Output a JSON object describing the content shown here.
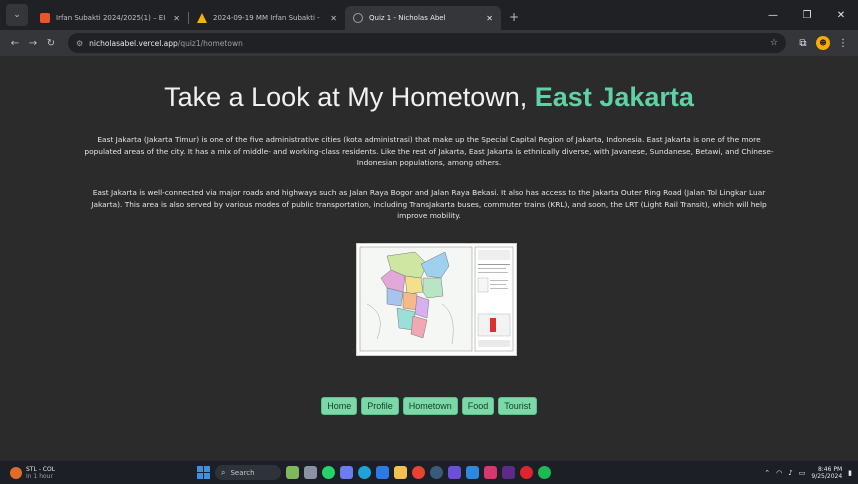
{
  "browser": {
    "tabs": [
      {
        "title": "Irfan Subakti 2024/2025(1) – EI",
        "favicon_color": "#e8542c",
        "active": false
      },
      {
        "title": "2024-09-19 MM Irfan Subakti -",
        "favicon_color": "#f4b400",
        "active": false
      },
      {
        "title": "Quiz 1 - Nicholas Abel",
        "favicon_color": "#9aa0a6",
        "active": true
      }
    ],
    "url_host": "nicholasabel.vercel.app",
    "url_path": "/quiz1/hometown",
    "profile_initial": "☻"
  },
  "page": {
    "heading_prefix": "Take a Look at My Hometown,",
    "heading_accent": "East Jakarta",
    "paragraph1": "East Jakarta (Jakarta Timur) is one of the five administrative cities (kota administrasi) that make up the Special Capital Region of Jakarta, Indonesia. East Jakarta is one of the more populated areas of the city. It has a mix of middle- and working-class residents. Like the rest of Jakarta, East Jakarta is ethnically diverse, with Javanese, Sundanese, Betawi, and Chinese-Indonesian populations, among others.",
    "paragraph2": "East Jakarta is well-connected via major roads and highways such as Jalan Raya Bogor and Jalan Raya Bekasi. It also has access to the Jakarta Outer Ring Road (Jalan Tol Lingkar Luar Jakarta). This area is also served by various modes of public transportation, including TransJakarta buses, commuter trains (KRL), and soon, the LRT (Light Rail Transit), which will help improve mobility.",
    "nav_buttons": [
      "Home",
      "Profile",
      "Hometown",
      "Food",
      "Tourist"
    ],
    "accent_color": "#5fd1a4",
    "button_color": "#7ad9a6"
  },
  "taskbar": {
    "weather_title": "STL - COL",
    "weather_sub": "In 1 hour",
    "search_placeholder": "Search",
    "time": "8:46 PM",
    "date": "9/25/2024"
  }
}
